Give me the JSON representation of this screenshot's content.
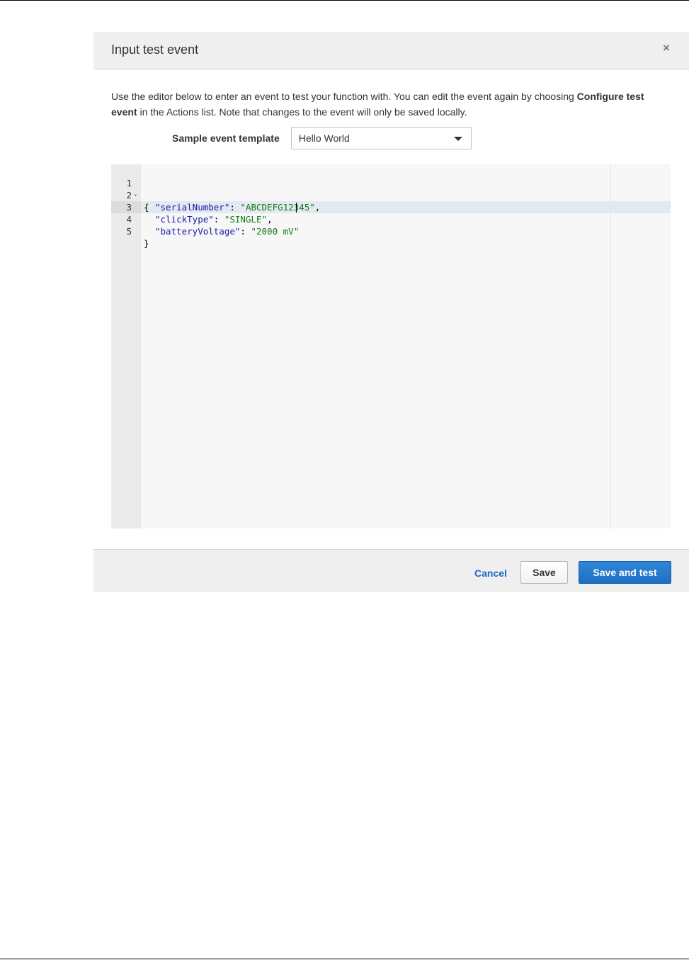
{
  "modal": {
    "title": "Input test event",
    "close_glyph": "×",
    "description": {
      "part1": "Use the editor below to enter an event to test your function with. You can edit the event again by choosing ",
      "bold1": "Configure test event",
      "part2": " in the Actions list. Note that changes to the event will only be saved locally."
    },
    "template": {
      "label": "Sample event template",
      "selected": "Hello World"
    },
    "editor": {
      "lines": [
        {
          "number": "1",
          "fold": "▾",
          "text": "{"
        },
        {
          "number": "2",
          "key": "\"serialNumber\"",
          "sep": ": ",
          "value": "\"ABCDEFG12345\"",
          "tail": ","
        },
        {
          "number": "3",
          "key": "\"clickType\"",
          "sep": ": ",
          "value": "\"SINGLE\"",
          "tail": ","
        },
        {
          "number": "4",
          "key": "\"batteryVoltage\"",
          "sep": ": ",
          "value": "\"2000 mV\"",
          "tail": ""
        },
        {
          "number": "5",
          "fold": "",
          "text": "}"
        }
      ],
      "active_line": 4
    },
    "footer": {
      "cancel_label": "Cancel",
      "save_label": "Save",
      "save_and_test_label": "Save and test"
    }
  },
  "colors": {
    "header_bg": "#efefef",
    "editor_bg": "#f7f7f7",
    "primary_button": "#1f6fc3",
    "link": "#1c6cc0",
    "json_key": "#1a1aa6",
    "json_string": "#1a7a1a"
  },
  "icons": {
    "close": "close-icon",
    "dropdown": "chevron-down-icon",
    "fold": "fold-arrow-icon"
  }
}
